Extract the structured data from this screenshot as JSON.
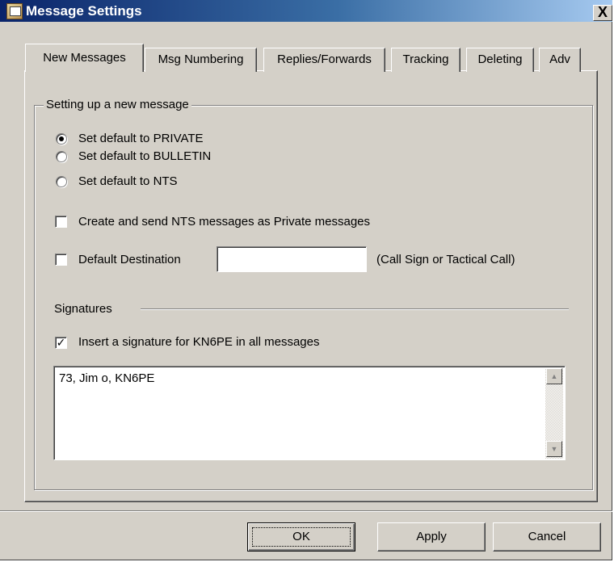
{
  "window": {
    "title": "Message Settings",
    "close_label": "X"
  },
  "tabs": [
    {
      "label": "New Messages",
      "active": true
    },
    {
      "label": "Msg Numbering",
      "active": false
    },
    {
      "label": "Replies/Forwards",
      "active": false
    },
    {
      "label": "Tracking",
      "active": false
    },
    {
      "label": "Deleting",
      "active": false
    },
    {
      "label": "Adv",
      "active": false
    }
  ],
  "group": {
    "label": "Setting up a new message",
    "radios": [
      {
        "label": "Set default to PRIVATE",
        "checked": true
      },
      {
        "label": "Set default to BULLETIN",
        "checked": false
      },
      {
        "label": "Set default to NTS",
        "checked": false
      }
    ],
    "nts_private": {
      "label": "Create and send NTS messages as Private messages",
      "checked": false
    },
    "default_destination": {
      "label": "Default Destination",
      "checked": false,
      "value": "",
      "hint": "(Call Sign or Tactical Call)"
    },
    "signatures": {
      "heading": "Signatures",
      "insert": {
        "label": "Insert a signature for KN6PE in all messages",
        "checked": true
      },
      "text": "73, Jim o, KN6PE"
    }
  },
  "buttons": {
    "ok": "OK",
    "apply": "Apply",
    "cancel": "Cancel"
  },
  "glyphs": {
    "check": "✓",
    "up": "▲",
    "down": "▼"
  }
}
